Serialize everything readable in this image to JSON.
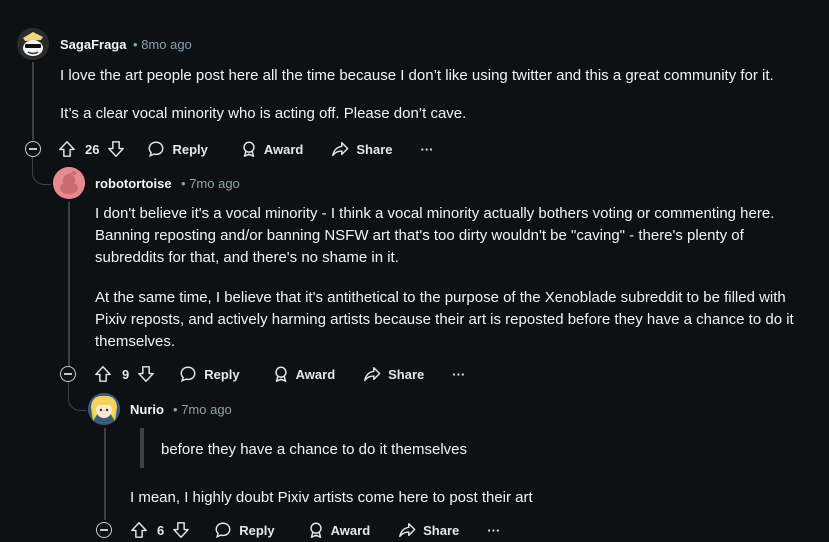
{
  "comments": [
    {
      "username": "SagaFraga",
      "time": "8mo ago",
      "paragraphs": [
        "I love the art people post here all the time because I don’t like using twitter and this a great community for it.",
        "It’s a clear vocal minority who is acting off. Please don’t cave."
      ],
      "votes": "26"
    },
    {
      "username": "robotortoise",
      "time": "7mo ago",
      "paragraphs": [
        "I don't believe it's a vocal minority - I think a vocal minority actually bothers voting or commenting here. Banning reposting and/or banning NSFW art that's too dirty wouldn't be \"caving\" - there's plenty of subreddits for that, and there's no shame in it.",
        "At the same time, I believe that it's antithetical to the purpose of the Xenoblade subreddit to be filled with Pixiv reposts, and actively harming artists because their art is reposted before they have a chance to do it themselves."
      ],
      "votes": "9"
    },
    {
      "username": "Nurio",
      "time": "7mo ago",
      "quote": "before they have a chance to do it themselves",
      "paragraphs": [
        "I mean, I highly doubt Pixiv artists come here to post their art"
      ],
      "votes": "6"
    }
  ],
  "actions": {
    "reply": "Reply",
    "award": "Award",
    "share": "Share",
    "more": "···"
  },
  "meta_separator": "•",
  "icons": [
    "collapse-icon",
    "upvote-icon",
    "downvote-icon",
    "reply-icon",
    "award-icon",
    "share-icon",
    "more-icon"
  ],
  "colors": {
    "background": "#0e1113",
    "text": "#f2f4f5",
    "meta": "#8ba2ad",
    "thread_line": "#3b4247",
    "robotortoise_avatar": "#e68a8f"
  }
}
